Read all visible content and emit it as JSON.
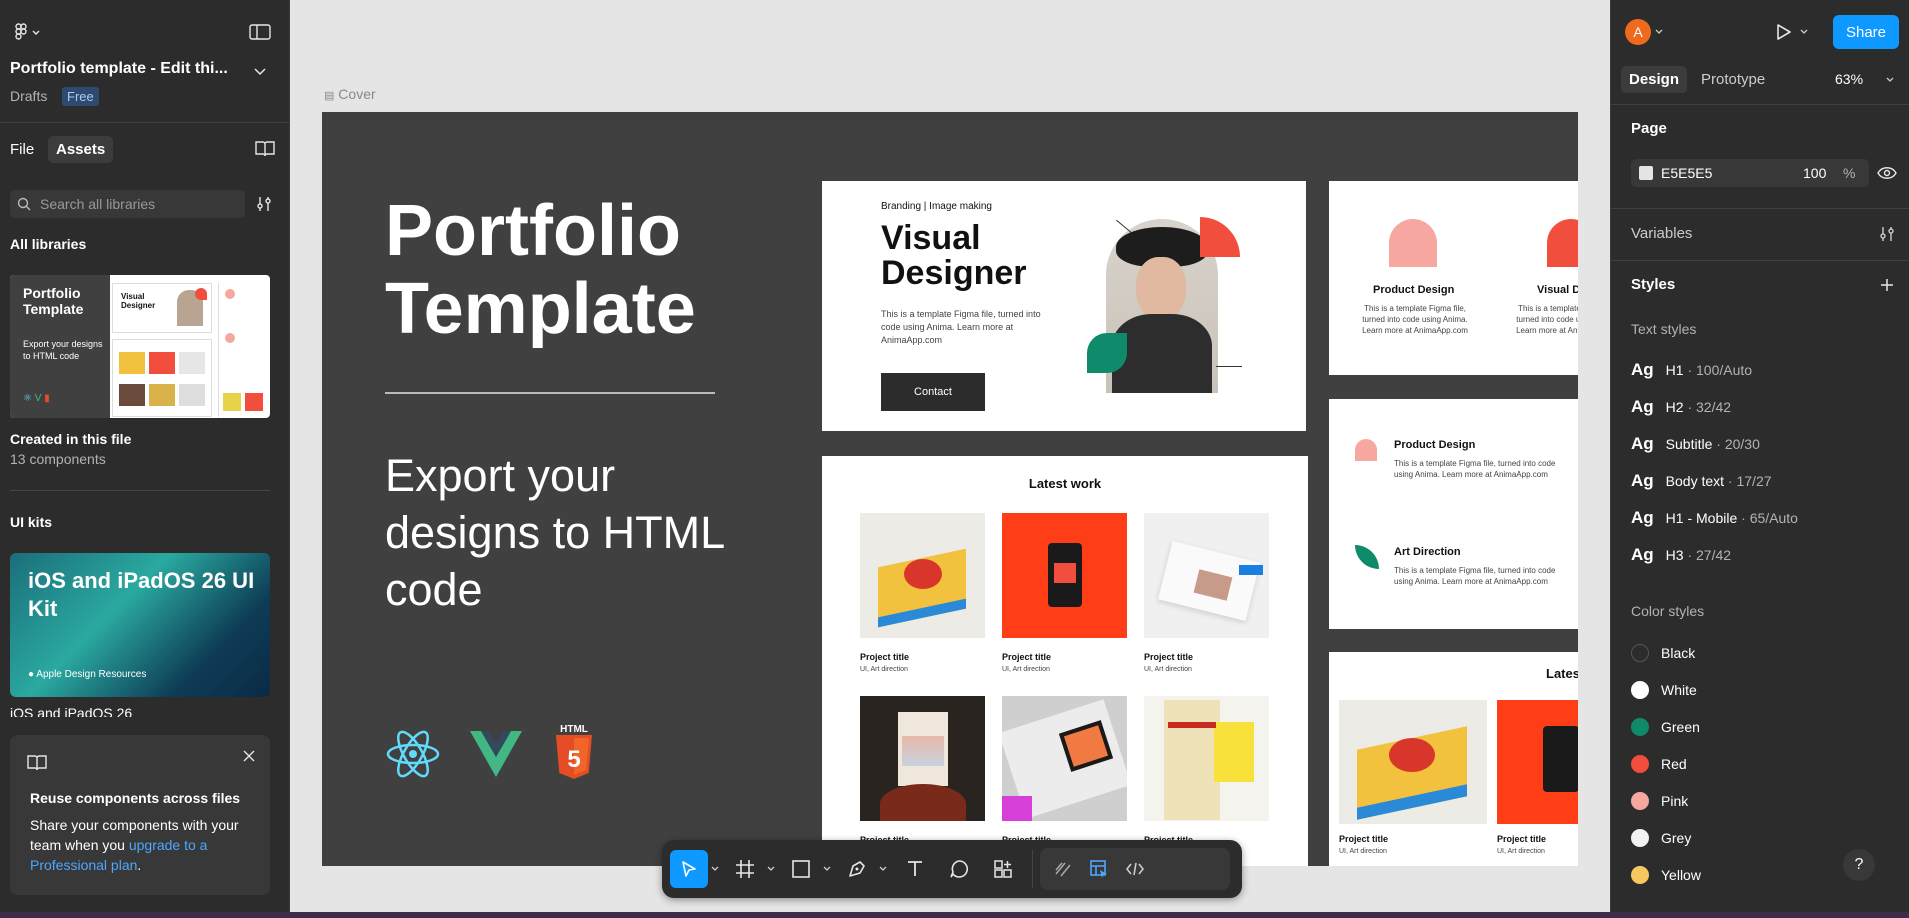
{
  "left_panel": {
    "file_title": "Portfolio template - Edit thi...",
    "location": "Drafts",
    "plan_badge": "Free",
    "tabs": [
      {
        "label": "File"
      },
      {
        "label": "Assets"
      }
    ],
    "search_placeholder": "Search all libraries",
    "all_libraries_heading": "All libraries",
    "library": {
      "thumb_title": "Portfolio Template",
      "thumb_sub": "Export your designs to HTML code",
      "thumb_visual": "Visual Designer",
      "name": "Created in this file",
      "count": "13 components"
    },
    "ui_kits_heading": "UI kits",
    "kit": {
      "title": "iOS and iPadOS 26 UI Kit",
      "brand": "Apple Design Resources",
      "caption": "iOS and iPadOS 26"
    },
    "promo": {
      "title": "Reuse components across files",
      "body": "Share your components with your team when you ",
      "link": "upgrade to a Professional plan",
      "period": "."
    }
  },
  "canvas": {
    "frame_label": "Cover",
    "hero_title_1": "Portfolio",
    "hero_title_2": "Template",
    "hero_sub": "Export your designs to HTML code",
    "html_badge": "HTML",
    "card1": {
      "tag": "Branding | Image making",
      "title_1": "Visual",
      "title_2": "Designer",
      "desc": "This is a template Figma file, turned into code using Anima. Learn more at AnimaApp.com",
      "button": "Contact"
    },
    "card2": {
      "title": "Product Design",
      "title2": "Visual De",
      "desc": "This is a template Figma file, turned into code using Anima. Learn more at AnimaApp.com"
    },
    "card3": {
      "item1_title": "Product Design",
      "item2_title": "Art Direction",
      "desc": "This is a template Figma file, turned into code using Anima. Learn more at AnimaApp.com"
    },
    "latest": {
      "title": "Latest work",
      "items": [
        {
          "title": "Project title",
          "sub": "UI, Art direction"
        },
        {
          "title": "Project title",
          "sub": "UI, Art direction"
        },
        {
          "title": "Project title",
          "sub": "UI, Art direction"
        },
        {
          "title": "Project title",
          "sub": ""
        },
        {
          "title": "Project title",
          "sub": ""
        },
        {
          "title": "Project title",
          "sub": ""
        }
      ]
    },
    "latest2": {
      "title": "Latest",
      "items": [
        {
          "title": "Project title",
          "sub": "UI, Art direction"
        },
        {
          "title": "Project title",
          "sub": "UI, Art direction"
        }
      ]
    }
  },
  "right_panel": {
    "avatar_letter": "A",
    "share_label": "Share",
    "tabs": [
      {
        "label": "Design"
      },
      {
        "label": "Prototype"
      }
    ],
    "zoom": "63%",
    "page_heading": "Page",
    "page_color": "E5E5E5",
    "page_opacity": "100",
    "percent": "%",
    "variables_heading": "Variables",
    "styles_heading": "Styles",
    "text_styles_heading": "Text styles",
    "text_styles": [
      {
        "ag": "Ag",
        "name": "H1",
        "spec": " · 100/Auto"
      },
      {
        "ag": "Ag",
        "name": "H2",
        "spec": " · 32/42"
      },
      {
        "ag": "Ag",
        "name": "Subtitle",
        "spec": " · 20/30"
      },
      {
        "ag": "Ag",
        "name": "Body text",
        "spec": " · 17/27"
      },
      {
        "ag": "Ag",
        "name": "H1 - Mobile",
        "spec": " · 65/Auto"
      },
      {
        "ag": "Ag",
        "name": "H3",
        "spec": " · 27/42"
      }
    ],
    "color_styles_heading": "Color styles",
    "color_styles": [
      {
        "name": "Black",
        "color": "#2c2c2c"
      },
      {
        "name": "White",
        "color": "#ffffff"
      },
      {
        "name": "Green",
        "color": "#0f8a6a"
      },
      {
        "name": "Red",
        "color": "#f24e3e"
      },
      {
        "name": "Pink",
        "color": "#f6a8a0"
      },
      {
        "name": "Grey",
        "color": "#f2f2f2"
      },
      {
        "name": "Yellow",
        "color": "#f7c85f"
      }
    ],
    "help": "?"
  },
  "colors": {
    "accent": "#0d99ff",
    "app_bg": "#2c2c2c",
    "canvas_bg": "#e5e5e5"
  }
}
